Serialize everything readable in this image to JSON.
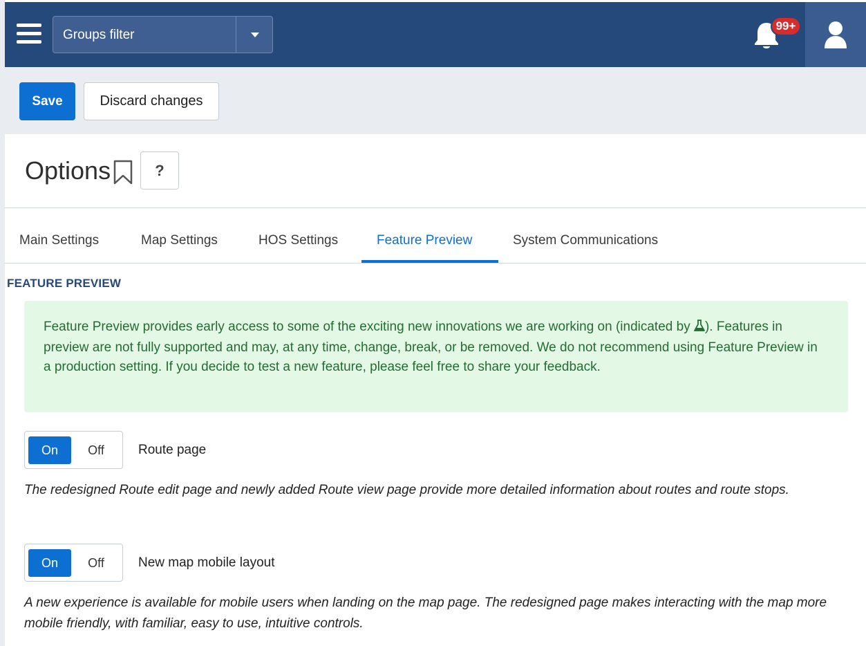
{
  "header": {
    "groups_filter_label": "Groups filter",
    "notification_badge": "99+"
  },
  "toolbar": {
    "save_label": "Save",
    "discard_label": "Discard changes"
  },
  "page": {
    "title": "Options",
    "help_label": "?"
  },
  "tabs": [
    {
      "label": "Main Settings",
      "active": false
    },
    {
      "label": "Map Settings",
      "active": false
    },
    {
      "label": "HOS Settings",
      "active": false
    },
    {
      "label": "Feature Preview",
      "active": true
    },
    {
      "label": "System Communications",
      "active": false
    }
  ],
  "section": {
    "title": "FEATURE PREVIEW",
    "info_before_icon": "Feature Preview provides early access to some of the exciting new innovations we are working on (indicated by ",
    "info_after_icon": "). Features in preview are not fully supported and may, at any time, change, break, or be removed. We do not recommend using Feature Preview in a production setting. If you decide to test a new feature, please feel free to share your feedback."
  },
  "features": [
    {
      "name": "Route page",
      "on_label": "On",
      "off_label": "Off",
      "state": "On",
      "description": "The redesigned Route edit page and newly added Route view page provide more detailed information about routes and route stops."
    },
    {
      "name": "New map mobile layout",
      "on_label": "On",
      "off_label": "Off",
      "state": "On",
      "description": "A new experience is available for mobile users when landing on the map page. The redesigned page makes interacting with the map more mobile friendly, with familiar, easy to use, intuitive controls."
    }
  ],
  "colors": {
    "header_bg": "#26497c",
    "accent": "#0d6fd1",
    "info_bg": "#e4f8e6",
    "info_text": "#256b34",
    "badge": "#d62c2c"
  },
  "icons": [
    "menu-icon",
    "caret-down-icon",
    "bell-icon",
    "user-icon",
    "bookmark-icon",
    "flask-icon"
  ]
}
